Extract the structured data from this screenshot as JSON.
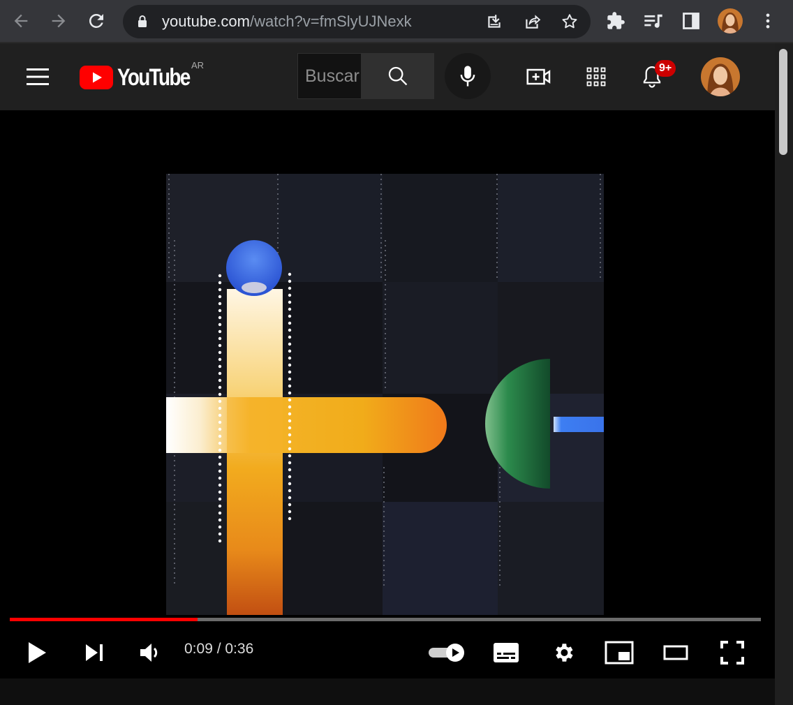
{
  "browser": {
    "url_domain": "youtube.com",
    "url_path": "/watch?v=fmSlyUJNexk"
  },
  "youtube": {
    "logo_text": "YouTube",
    "country_code": "AR",
    "search_placeholder": "Buscar",
    "notification_count": "9+"
  },
  "player": {
    "current_time": "0:09",
    "duration": "0:36",
    "time_display": "0:09 / 0:36",
    "progress_fraction": 0.25,
    "autoplay": "on"
  },
  "colors": {
    "youtube_red": "#ff0000",
    "badge_red": "#cc0000",
    "progress_red": "#ff0000"
  },
  "icons": [
    "back-arrow-icon",
    "forward-arrow-icon",
    "reload-icon",
    "lock-icon",
    "install-app-icon",
    "share-icon",
    "bookmark-star-icon",
    "extensions-icon",
    "media-controls-icon",
    "side-panel-icon",
    "chrome-menu-icon",
    "hamburger-menu-icon",
    "search-icon",
    "microphone-icon",
    "create-video-icon",
    "apps-grid-icon",
    "bell-icon",
    "play-icon",
    "next-icon",
    "volume-icon",
    "autoplay-toggle-icon",
    "subtitles-icon",
    "settings-gear-icon",
    "miniplayer-icon",
    "theater-mode-icon",
    "fullscreen-icon"
  ]
}
